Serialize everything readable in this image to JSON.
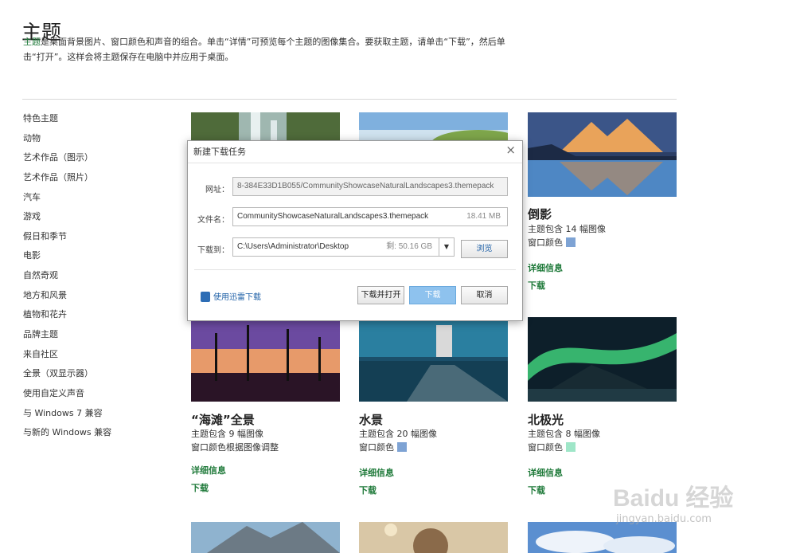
{
  "page": {
    "title": "主题",
    "intro_highlight": "主题",
    "intro_text": "是桌面背景图片、窗口颜色和声音的组合。单击“详情”可预览每个主题的图像集合。要获取主题，请单击“下载”，然后单击“打开”。这样会将主题保存在电脑中并应用于桌面。"
  },
  "categories": [
    "特色主题",
    "动物",
    "艺术作品（图示）",
    "艺术作品（照片）",
    "汽车",
    "游戏",
    "假日和季节",
    "电影",
    "自然奇观",
    "地方和风景",
    "植物和花卉",
    "品牌主题",
    "来自社区",
    "全景（双显示器）",
    "使用自定义声音",
    "与 Windows 7 兼容",
    "与新的 Windows 兼容"
  ],
  "themes": [
    {
      "title": "倒影",
      "count": "主题包含 14 幅图像",
      "color_label": "窗口颜色",
      "color": "#7ea3d4",
      "details": "详细信息",
      "download": "下载"
    },
    {
      "title": "“海滩”全景",
      "count": "主题包含 9 幅图像",
      "color_label": "窗口颜色根据图像调整",
      "details": "详细信息",
      "download": "下载"
    },
    {
      "title": "水景",
      "count": "主题包含 20 幅图像",
      "color_label": "窗口颜色",
      "color": "#7ea3d4",
      "details": "详细信息",
      "download": "下载"
    },
    {
      "title": "北极光",
      "count": "主题包含 8 幅图像",
      "color_label": "窗口颜色",
      "color": "#9fe6c8",
      "details": "详细信息",
      "download": "下载"
    }
  ],
  "dialog": {
    "title": "新建下载任务",
    "close": "×",
    "url_label": "网址：",
    "url_value": "8-384E33D1B055/CommunityShowcaseNaturalLandscapes3.themepack",
    "filename_label": "文件名：",
    "filename_value": "CommunityShowcaseNaturalLandscapes3.themepack",
    "filesize": "18.41 MB",
    "saveto_label": "下载到：",
    "saveto_value": "C:\\Users\\Administrator\\Desktop",
    "free_space": "剩: 50.16 GB",
    "dropdown_arrow": "▼",
    "browse_button": "浏览",
    "thunder_link": "使用迅雷下载",
    "download_open_button": "下载并打开",
    "download_button": "下载",
    "cancel_button": "取消"
  },
  "watermark": {
    "brand": "Bai",
    "brand2": "du",
    "cn": "经验",
    "url": "jingyan.baidu.com"
  }
}
